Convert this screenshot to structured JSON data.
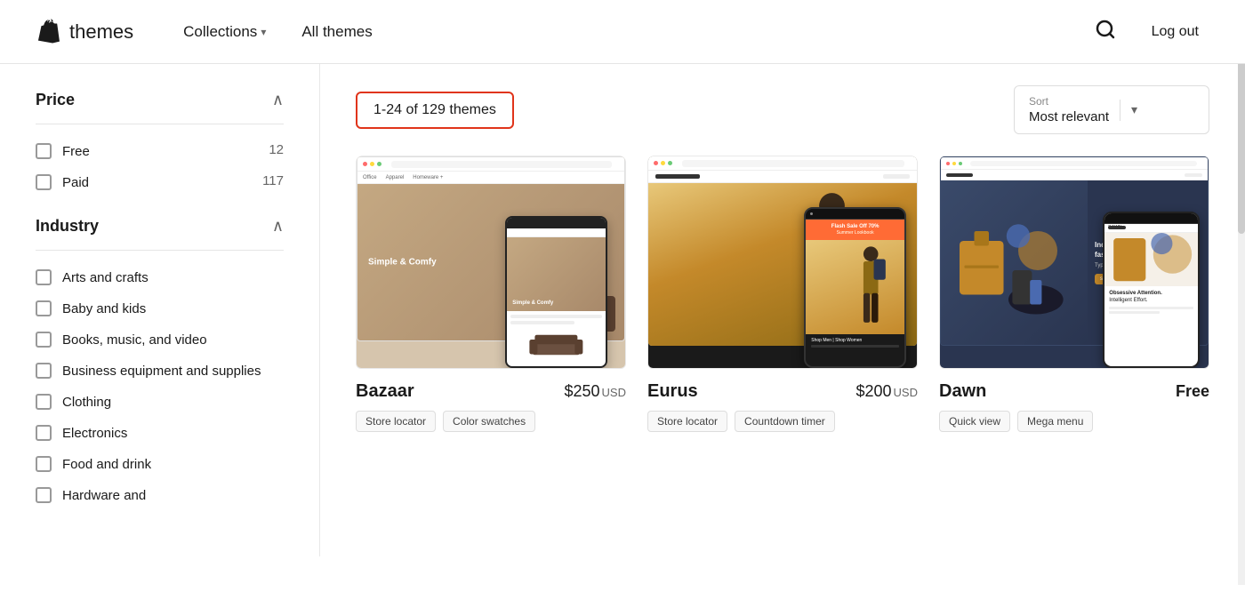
{
  "header": {
    "logo_text": "themes",
    "nav": {
      "collections_label": "Collections",
      "all_themes_label": "All themes"
    },
    "search_label": "Search",
    "logout_label": "Log out"
  },
  "sidebar": {
    "price_section": {
      "title": "Price",
      "items": [
        {
          "label": "Free",
          "count": "12"
        },
        {
          "label": "Paid",
          "count": "117"
        }
      ]
    },
    "industry_section": {
      "title": "Industry",
      "items": [
        {
          "label": "Arts and crafts",
          "count": ""
        },
        {
          "label": "Baby and kids",
          "count": ""
        },
        {
          "label": "Books, music, and video",
          "count": ""
        },
        {
          "label": "Business equipment and supplies",
          "count": ""
        },
        {
          "label": "Clothing",
          "count": ""
        },
        {
          "label": "Electronics",
          "count": ""
        },
        {
          "label": "Food and drink",
          "count": ""
        },
        {
          "label": "Hardware and",
          "count": ""
        }
      ]
    }
  },
  "content": {
    "results_count": "1-24 of 129 themes",
    "sort": {
      "label": "Sort",
      "value": "Most relevant"
    },
    "themes": [
      {
        "name": "Bazaar",
        "price": "$250",
        "currency": "USD",
        "free": false,
        "tags": [
          "Store locator",
          "Color swatches"
        ]
      },
      {
        "name": "Eurus",
        "price": "$200",
        "currency": "USD",
        "free": false,
        "tags": [
          "Store locator",
          "Countdown timer"
        ]
      },
      {
        "name": "Dawn",
        "price": "Free",
        "currency": "",
        "free": true,
        "tags": [
          "Quick view",
          "Mega menu"
        ]
      }
    ]
  }
}
